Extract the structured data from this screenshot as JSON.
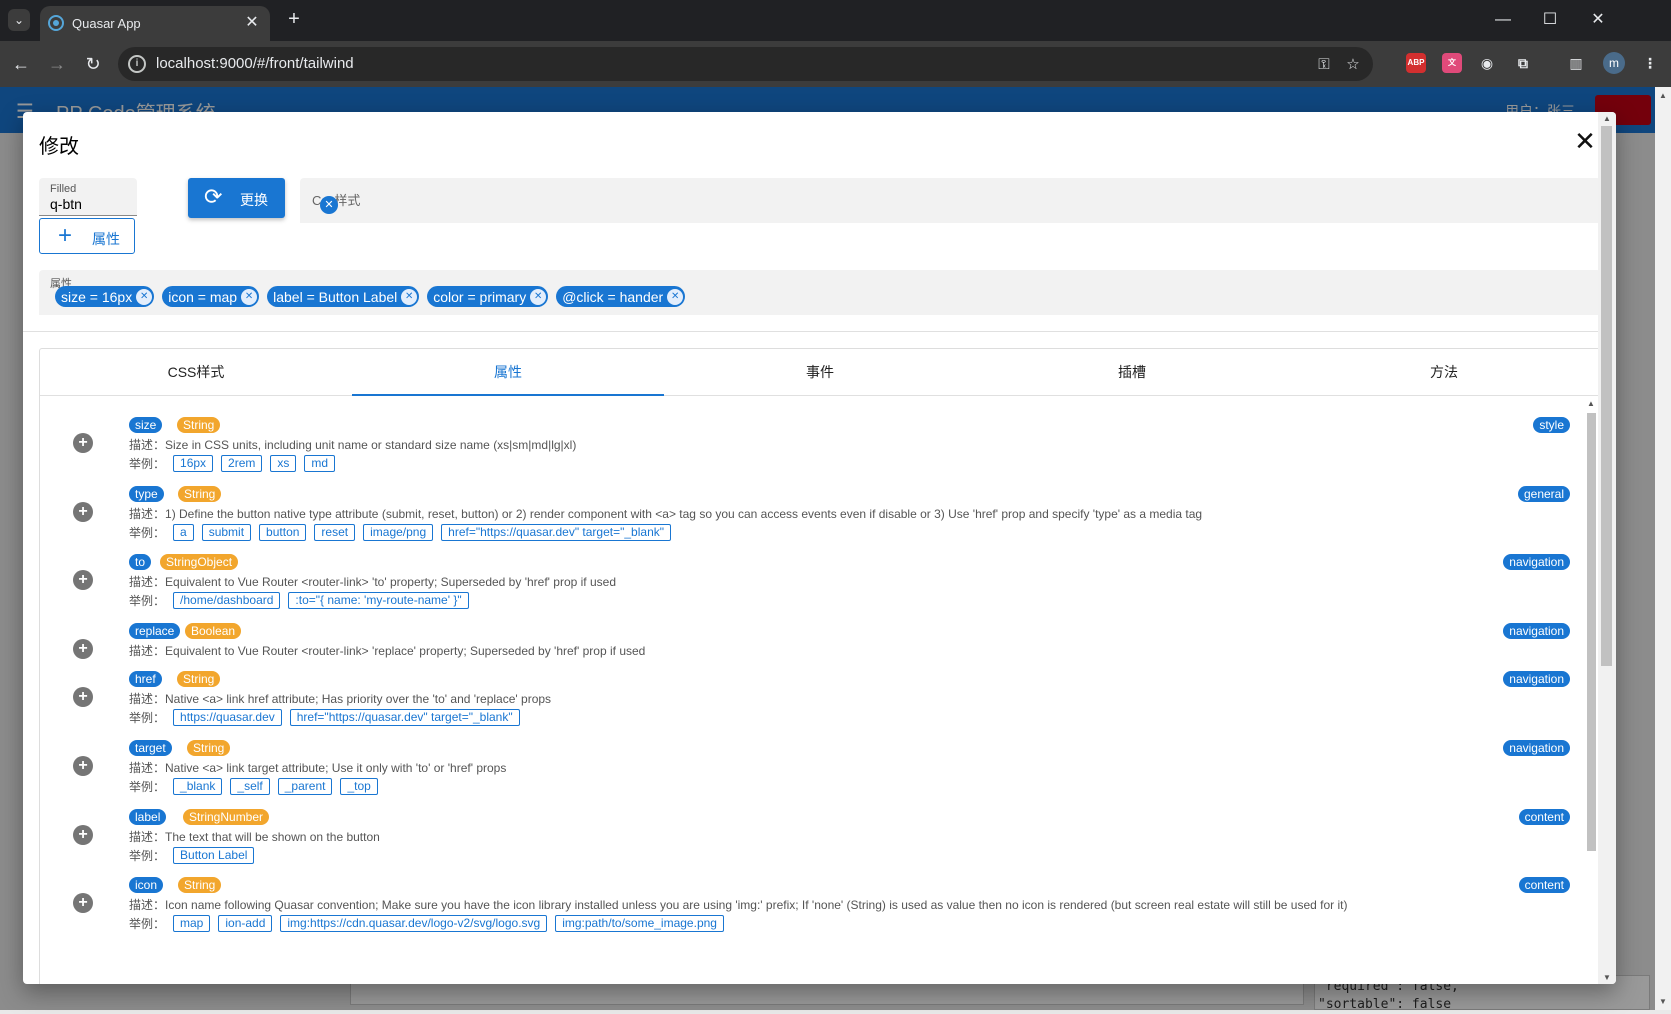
{
  "browser": {
    "tab_title": "Quasar App",
    "url": "localhost:9000/#/front/tailwind",
    "profile_initial": "m",
    "new_tab": "+",
    "tab_close": "✕"
  },
  "app": {
    "title": "PP Code管理系统",
    "user": "用户：张三",
    "bg_code": "\"required\": false,\n\"sortable\": false"
  },
  "dialog": {
    "title": "修改",
    "component_field": {
      "label": "Filled",
      "value": "q-btn"
    },
    "add_attr_button": "属性",
    "replace_button": "更换",
    "css_input_placeholder": "Css样式",
    "attr_field": {
      "label": "属性",
      "chips": [
        "size = 16px",
        "icon = map",
        "label = Button Label",
        "color = primary",
        "@click = hander"
      ]
    },
    "tabs": [
      {
        "label": "CSS样式",
        "active": false
      },
      {
        "label": "属性",
        "active": true
      },
      {
        "label": "事件",
        "active": false
      },
      {
        "label": "插槽",
        "active": false
      },
      {
        "label": "方法",
        "active": false
      }
    ],
    "desc_prefix": "描述：",
    "example_prefix": "举例：",
    "props": [
      {
        "name": "size",
        "type": "String",
        "category": "style",
        "desc": "Size in CSS units, including unit name or standard size name (xs|sm|md|lg|xl)",
        "examples": [
          "16px",
          "2rem",
          "xs",
          "md"
        ]
      },
      {
        "name": "type",
        "type": "String",
        "category": "general",
        "desc": "1) Define the button native type attribute (submit, reset, button) or 2) render component with <a> tag so you can access events even if disable or 3) Use 'href' prop and specify 'type' as a media tag",
        "examples": [
          "a",
          "submit",
          "button",
          "reset",
          "image/png",
          "href=\"https://quasar.dev\" target=\"_blank\""
        ]
      },
      {
        "name": "to",
        "type": "StringObject",
        "category": "navigation",
        "desc": "Equivalent to Vue Router <router-link> 'to' property; Superseded by 'href' prop if used",
        "examples": [
          "/home/dashboard",
          ":to=\"{ name: 'my-route-name' }\""
        ]
      },
      {
        "name": "replace",
        "type": "Boolean",
        "category": "navigation",
        "desc": "Equivalent to Vue Router <router-link> 'replace' property; Superseded by 'href' prop if used",
        "examples": []
      },
      {
        "name": "href",
        "type": "String",
        "category": "navigation",
        "desc": "Native <a> link href attribute; Has priority over the 'to' and 'replace' props",
        "examples": [
          "https://quasar.dev",
          "href=\"https://quasar.dev\" target=\"_blank\""
        ]
      },
      {
        "name": "target",
        "type": "String",
        "category": "navigation",
        "desc": "Native <a> link target attribute; Use it only with 'to' or 'href' props",
        "examples": [
          "_blank",
          "_self",
          "_parent",
          "_top"
        ]
      },
      {
        "name": "label",
        "type": "StringNumber",
        "category": "content",
        "desc": "The text that will be shown on the button",
        "examples": [
          "Button Label"
        ]
      },
      {
        "name": "icon",
        "type": "String",
        "category": "content",
        "desc": "Icon name following Quasar convention; Make sure you have the icon library installed unless you are using 'img:' prefix; If 'none' (String) is used as value then no icon is rendered (but screen real estate will still be used for it)",
        "examples": [
          "map",
          "ion-add",
          "img:https://cdn.quasar.dev/logo-v2/svg/logo.svg",
          "img:path/to/some_image.png"
        ]
      }
    ]
  },
  "colors": {
    "primary": "#1976d2",
    "type_badge": "#f2a62d",
    "negative": "#c10015"
  }
}
